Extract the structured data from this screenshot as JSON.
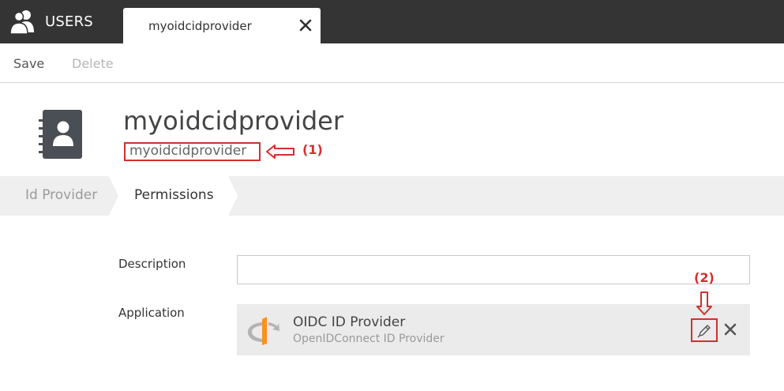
{
  "header": {
    "app_title": "USERS",
    "tab": {
      "label": "myoidcidprovider"
    }
  },
  "toolbar": {
    "save_label": "Save",
    "delete_label": "Delete"
  },
  "entity": {
    "title": "myoidcidprovider",
    "subtitle": "myoidcidprovider"
  },
  "annotations": {
    "a1": "(1)",
    "a2": "(2)"
  },
  "steps": [
    {
      "label": "Id Provider",
      "active": false
    },
    {
      "label": "Permissions",
      "active": true
    }
  ],
  "form": {
    "description_label": "Description",
    "description_value": "",
    "application_label": "Application",
    "application": {
      "name": "OIDC ID Provider",
      "description": "OpenIDConnect ID Provider"
    }
  },
  "colors": {
    "topbar": "#343434",
    "annotation": "#d32f2f",
    "stepbar": "#efefef",
    "oidc_orange": "#f7931e"
  },
  "icons": [
    "users-icon",
    "close-icon",
    "address-book-icon",
    "openid-logo-icon",
    "pencil-icon",
    "remove-icon"
  ]
}
